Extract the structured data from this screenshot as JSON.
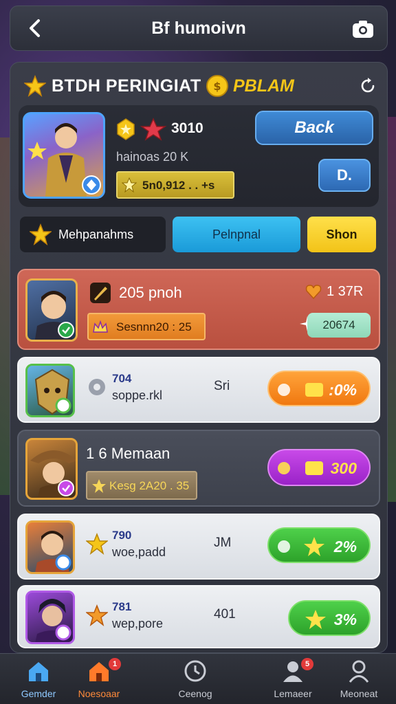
{
  "topbar": {
    "title": "Bf humoivn"
  },
  "header": {
    "title_left": "BTDH PERINGIAT",
    "title_right": "PBLAM"
  },
  "profile": {
    "score": "3010",
    "subtitle": "hainoas 20 K",
    "chip_text": "5n0,912 . . +s",
    "back_label": "Back",
    "d_label": "D."
  },
  "tabs": [
    {
      "label": "Mehpanahms"
    },
    {
      "label": "Pelnpnal"
    },
    {
      "label": "Shon"
    }
  ],
  "rows": [
    {
      "name": "205 pnoh",
      "chip": "Sesnnn20 : 25",
      "rank": "1 37R",
      "pill": "20674"
    },
    {
      "number": "704",
      "sub": "soppe.rkl",
      "mid": "Sri",
      "pill": ":0%"
    },
    {
      "name": "1 6 Memaan",
      "chip": "Kesg 2A20 . 35",
      "pill": "300"
    },
    {
      "number": "790",
      "sub": "woe,padd",
      "mid": "JM",
      "pill": "2%"
    },
    {
      "number": "781",
      "sub": "wep,pore",
      "mid": "401",
      "pill": "3%"
    }
  ],
  "nav": [
    {
      "label": "Gemder",
      "badge": ""
    },
    {
      "label": "Noesoaar",
      "badge": "1"
    },
    {
      "label": "Ceenog",
      "badge": ""
    },
    {
      "label": "Lemaeer",
      "badge": "5"
    },
    {
      "label": "Meoneat",
      "badge": ""
    }
  ],
  "colors": {
    "accent_blue": "#3f8ad6",
    "gold": "#f5c518",
    "red_row": "#cf6757",
    "shop_yellow": "#ffe04a"
  }
}
